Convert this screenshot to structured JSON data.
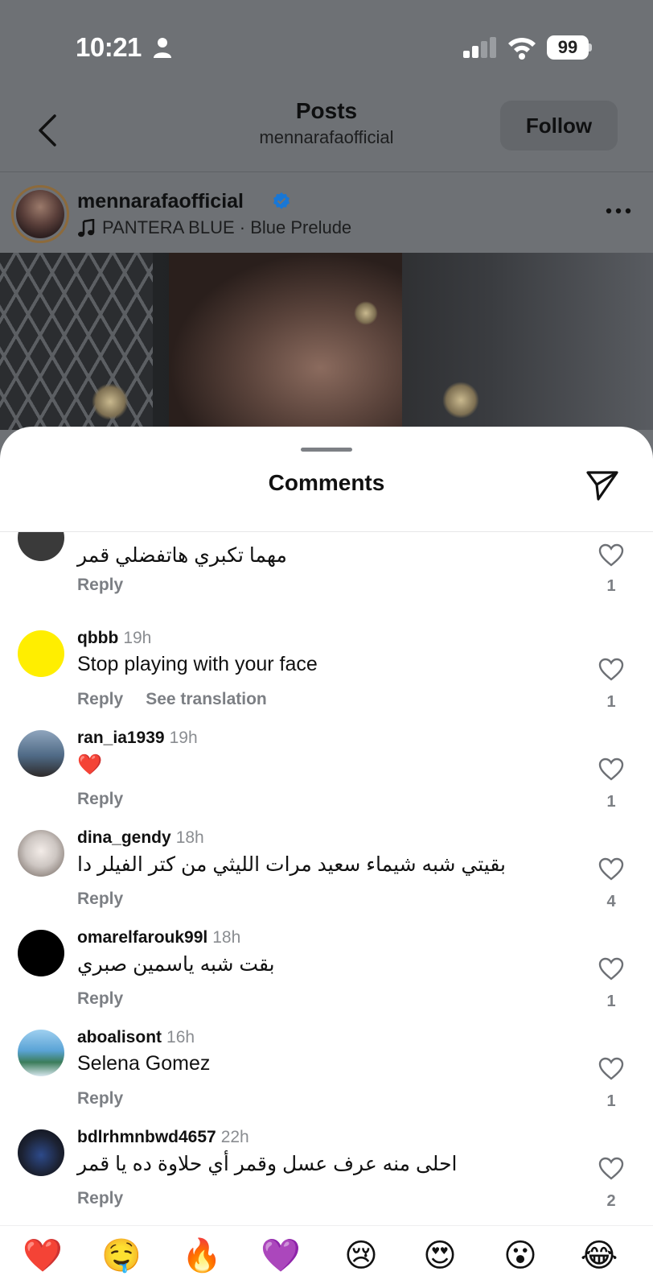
{
  "status_bar": {
    "time": "10:21",
    "battery": "99"
  },
  "nav": {
    "title": "Posts",
    "subtitle": "mennarafaofficial",
    "follow_label": "Follow"
  },
  "post": {
    "username": "mennarafaofficial",
    "music": "PANTERA BLUE · Blue Prelude"
  },
  "sheet": {
    "title": "Comments"
  },
  "comments": [
    {
      "username": "",
      "time": "",
      "text": "مهما تكبري هاتفضلي قمر",
      "actions": [
        "Reply"
      ],
      "likes": "1",
      "avatar_color": "#3a3a3a"
    },
    {
      "username": "qbbb",
      "time": "19h",
      "text": "Stop playing with your face",
      "actions": [
        "Reply",
        "See translation"
      ],
      "likes": "1",
      "avatar_color": "#ffee00"
    },
    {
      "username": "ran_ia1939",
      "time": "19h",
      "text": "❤️",
      "actions": [
        "Reply"
      ],
      "likes": "1",
      "avatar_color": "#4f6a86"
    },
    {
      "username": "dina_gendy",
      "time": "18h",
      "text": "بقيتي شبه شيماء سعيد مرات الليثي من كتر الفيلر دا",
      "actions": [
        "Reply"
      ],
      "likes": "4",
      "avatar_color": "#cdc6c2"
    },
    {
      "username": "omarelfarouk99l",
      "time": "18h",
      "text": "بقت شبه ياسمين صبري",
      "actions": [
        "Reply"
      ],
      "likes": "1",
      "avatar_color": "#000000"
    },
    {
      "username": "aboalisont",
      "time": "16h",
      "text": "Selena Gomez",
      "actions": [
        "Reply"
      ],
      "likes": "1",
      "avatar_color": "#5aa3d6"
    },
    {
      "username": "bdlrhmnbwd4657",
      "time": "22h",
      "text": "احلى منه عرف عسل وقمر أي حلاوة ده يا قمر",
      "actions": [
        "Reply"
      ],
      "likes": "2",
      "avatar_color": "#1c2233"
    }
  ],
  "emoji_bar": [
    "❤️",
    "🤤",
    "🔥",
    "💜",
    "😢",
    "😍",
    "😮",
    "😂"
  ]
}
